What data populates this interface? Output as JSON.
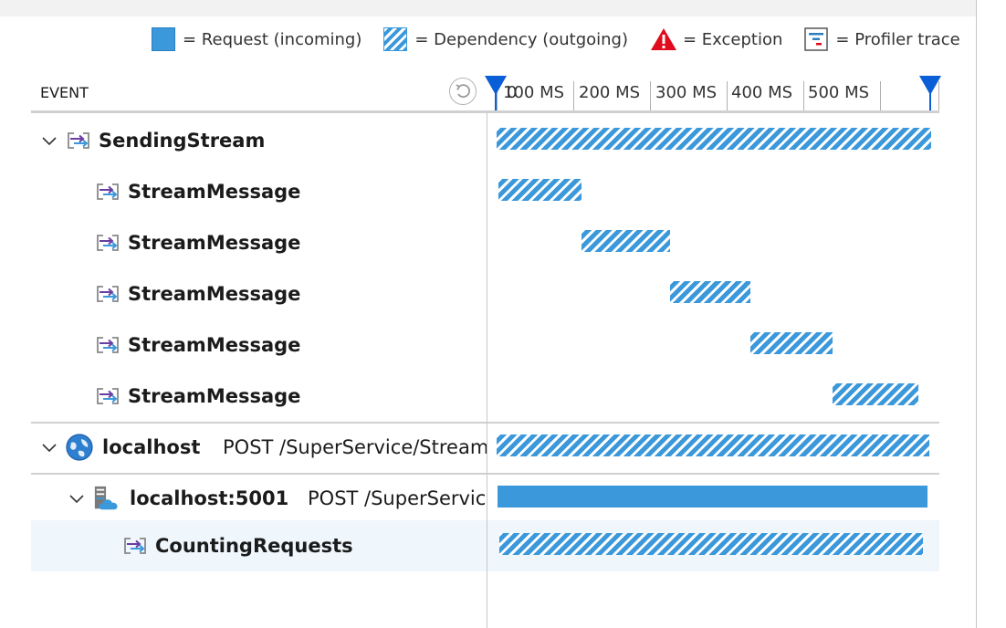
{
  "legend": {
    "request": "= Request (incoming)",
    "dependency": "= Dependency (outgoing)",
    "exception": "= Exception",
    "profiler": "= Profiler trace"
  },
  "header": {
    "event_label": "EVENT",
    "axis": [
      "0",
      "100 MS",
      "200 MS",
      "300 MS",
      "400 MS",
      "500 MS"
    ]
  },
  "colors": {
    "accent": "#3a98db",
    "marker": "#0a5fd6",
    "exception": "#e00b1c",
    "selected_row": "#eff6fc"
  },
  "rows": [
    {
      "name": "SendingStream",
      "detail": "",
      "icon": "dependency-icon",
      "expanded": true,
      "bar": "hatch"
    },
    {
      "name": "StreamMessage",
      "detail": "",
      "icon": "dependency-icon",
      "bar": "hatch"
    },
    {
      "name": "StreamMessage",
      "detail": "",
      "icon": "dependency-icon",
      "bar": "hatch"
    },
    {
      "name": "StreamMessage",
      "detail": "",
      "icon": "dependency-icon",
      "bar": "hatch"
    },
    {
      "name": "StreamMessage",
      "detail": "",
      "icon": "dependency-icon",
      "bar": "hatch"
    },
    {
      "name": "StreamMessage",
      "detail": "",
      "icon": "dependency-icon",
      "bar": "hatch"
    },
    {
      "name": "localhost",
      "detail": "POST /SuperService/Stream",
      "icon": "globe-icon",
      "expanded": true,
      "bar": "hatch"
    },
    {
      "name": "localhost:5001",
      "detail": "POST /SuperServic",
      "icon": "server-cloud-icon",
      "expanded": true,
      "bar": "solid"
    },
    {
      "name": "CountingRequests",
      "detail": "",
      "icon": "dependency-icon",
      "selected": true,
      "bar": "hatch"
    }
  ]
}
